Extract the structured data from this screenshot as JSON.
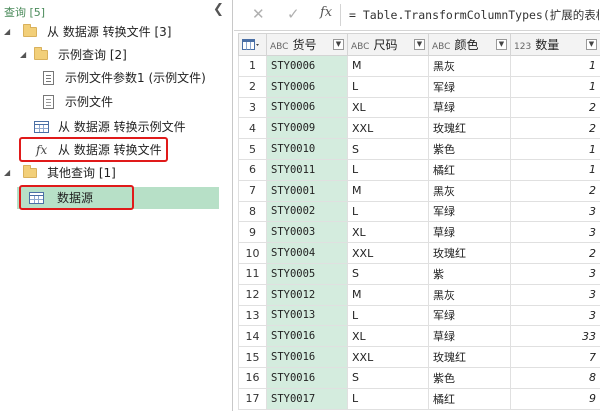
{
  "queries_pane": {
    "header": "查询 [5]",
    "collapse_glyph": "❮",
    "items": [
      {
        "label": "从 数据源 转换文件 [3]",
        "icon": "folder-icon",
        "caret": "◢"
      },
      {
        "label": "示例查询 [2]",
        "icon": "folder-icon",
        "caret": "◢"
      },
      {
        "label": "示例文件参数1 (示例文件)",
        "icon": "parameter-icon"
      },
      {
        "label": "示例文件",
        "icon": "document-icon"
      },
      {
        "label": "从 数据源 转换示例文件",
        "icon": "table-icon"
      },
      {
        "label": "从 数据源 转换文件",
        "icon": "function-icon",
        "glyph": "fx"
      },
      {
        "label": "其他查询 [1]",
        "icon": "folder-icon",
        "caret": "◢"
      },
      {
        "label": "数据源",
        "icon": "table-icon"
      }
    ]
  },
  "formula_bar": {
    "cancel_glyph": "✕",
    "confirm_glyph": "✓",
    "fx_glyph": "fx",
    "formula": "= Table.TransformColumnTypes(扩展的表格"
  },
  "grid": {
    "columns": [
      {
        "type": "ABC",
        "name": "货号"
      },
      {
        "type": "ABC",
        "name": "尺码"
      },
      {
        "type": "ABC",
        "name": "颜色"
      },
      {
        "type": "123",
        "name": "数量"
      }
    ],
    "dropdown_glyph": "▼",
    "rows": [
      {
        "n": "1",
        "id": "STY0006",
        "size": "M",
        "color": "黑灰",
        "qty": "1"
      },
      {
        "n": "2",
        "id": "STY0006",
        "size": "L",
        "color": "军绿",
        "qty": "1"
      },
      {
        "n": "3",
        "id": "STY0006",
        "size": "XL",
        "color": "草绿",
        "qty": "2"
      },
      {
        "n": "4",
        "id": "STY0009",
        "size": "XXL",
        "color": "玫瑰红",
        "qty": "2"
      },
      {
        "n": "5",
        "id": "STY0010",
        "size": "S",
        "color": "紫色",
        "qty": "1"
      },
      {
        "n": "6",
        "id": "STY0011",
        "size": "L",
        "color": "橘红",
        "qty": "1"
      },
      {
        "n": "7",
        "id": "STY0001",
        "size": "M",
        "color": "黑灰",
        "qty": "2"
      },
      {
        "n": "8",
        "id": "STY0002",
        "size": "L",
        "color": "军绿",
        "qty": "3"
      },
      {
        "n": "9",
        "id": "STY0003",
        "size": "XL",
        "color": "草绿",
        "qty": "3"
      },
      {
        "n": "10",
        "id": "STY0004",
        "size": "XXL",
        "color": "玫瑰红",
        "qty": "2"
      },
      {
        "n": "11",
        "id": "STY0005",
        "size": "S",
        "color": "紫",
        "qty": "3"
      },
      {
        "n": "12",
        "id": "STY0012",
        "size": "M",
        "color": "黑灰",
        "qty": "3"
      },
      {
        "n": "13",
        "id": "STY0013",
        "size": "L",
        "color": "军绿",
        "qty": "3"
      },
      {
        "n": "14",
        "id": "STY0016",
        "size": "XL",
        "color": "草绿",
        "qty": "33"
      },
      {
        "n": "15",
        "id": "STY0016",
        "size": "XXL",
        "color": "玫瑰红",
        "qty": "7"
      },
      {
        "n": "16",
        "id": "STY0016",
        "size": "S",
        "color": "紫色",
        "qty": "8"
      },
      {
        "n": "17",
        "id": "STY0017",
        "size": "L",
        "color": "橘红",
        "qty": "9"
      }
    ]
  }
}
